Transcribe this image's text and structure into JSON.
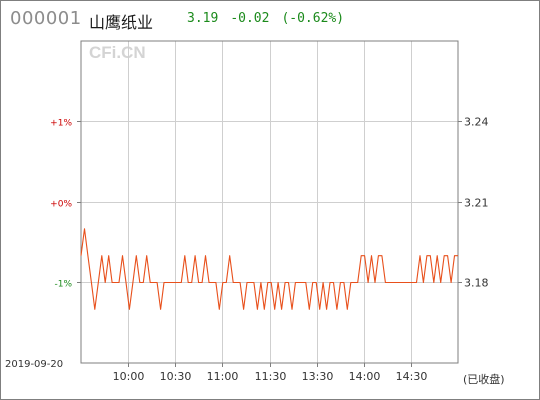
{
  "header": {
    "code": "000001",
    "name": "山鹰纸业",
    "price": "3.19",
    "change": "-0.02",
    "change_pct": "(-0.62%)",
    "down_color": "#1b8a1b"
  },
  "watermark": "CFi.CN",
  "footer": {
    "date": "2019-09-20",
    "status": "(已收盘)"
  },
  "chart_data": {
    "type": "line",
    "title": "",
    "xlabel": "",
    "ylabel": "",
    "x_ticks": [
      "10:00",
      "10:30",
      "11:00",
      "11:30",
      "13:30",
      "14:00",
      "14:30"
    ],
    "left_ticks": [
      {
        "label": "+1%",
        "value": 3.24,
        "color": "#cc0000"
      },
      {
        "label": "+0%",
        "value": 3.21,
        "color": "#cc0000"
      },
      {
        "label": "-1%",
        "value": 3.18,
        "color": "#1b8a1b"
      }
    ],
    "right_ticks": [
      "3.24",
      "3.21",
      "3.18"
    ],
    "ylim": [
      3.15,
      3.27
    ],
    "reference_price": 3.21,
    "grid": true,
    "line_color": "#e8501c",
    "series": [
      {
        "values": [
          3.19,
          3.2,
          3.19,
          3.18,
          3.17,
          3.18,
          3.19,
          3.18,
          3.19,
          3.18,
          3.18,
          3.18,
          3.19,
          3.18,
          3.17,
          3.18,
          3.19,
          3.18,
          3.18,
          3.19,
          3.18,
          3.18,
          3.18,
          3.17,
          3.18,
          3.18,
          3.18,
          3.18,
          3.18,
          3.18,
          3.19,
          3.18,
          3.18,
          3.19,
          3.18,
          3.18,
          3.19,
          3.18,
          3.18,
          3.18,
          3.17,
          3.18,
          3.18,
          3.19,
          3.18,
          3.18,
          3.18,
          3.17,
          3.18,
          3.18,
          3.18,
          3.17,
          3.18,
          3.17,
          3.18,
          3.18,
          3.17,
          3.18,
          3.17,
          3.18,
          3.18,
          3.17,
          3.18,
          3.18,
          3.18,
          3.18,
          3.17,
          3.18,
          3.18,
          3.17,
          3.18,
          3.17,
          3.18,
          3.18,
          3.17,
          3.18,
          3.18,
          3.17,
          3.18,
          3.18,
          3.18,
          3.19,
          3.19,
          3.18,
          3.19,
          3.18,
          3.19,
          3.19,
          3.18,
          3.18,
          3.18,
          3.18,
          3.18,
          3.18,
          3.18,
          3.18,
          3.18,
          3.18,
          3.19,
          3.18,
          3.19,
          3.19,
          3.18,
          3.19,
          3.18,
          3.19,
          3.19,
          3.18,
          3.19,
          3.19
        ]
      }
    ]
  }
}
